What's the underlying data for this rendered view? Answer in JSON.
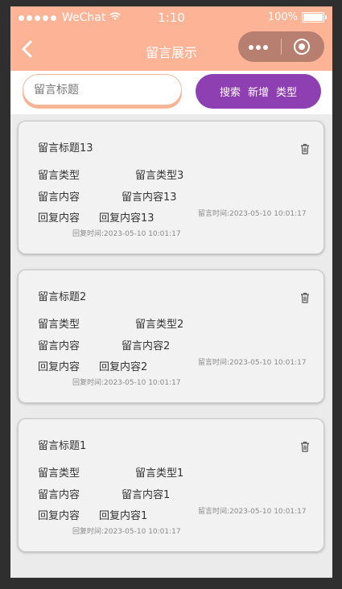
{
  "status_bar": {
    "carrier": "WeChat",
    "time": "1:10",
    "battery": "100%"
  },
  "nav": {
    "title": "留言展示"
  },
  "search": {
    "placeholder": "留言标题",
    "buttons": [
      "搜索",
      "新增",
      "类型"
    ]
  },
  "messages": [
    {
      "title": "留言标题13",
      "type_label": "留言类型",
      "type_value": "留言类型3",
      "content_label": "留言内容",
      "content_value": "留言内容13",
      "reply_label": "回复内容",
      "reply_value": "回复内容13",
      "message_time": "留言时间:2023-05-10 10:01:17",
      "reply_time": "回复时间:2023-05-10 10:01:17"
    },
    {
      "title": "留言标题2",
      "type_label": "留言类型",
      "type_value": "留言类型2",
      "content_label": "留言内容",
      "content_value": "留言内容2",
      "reply_label": "回复内容",
      "reply_value": "回复内容2",
      "message_time": "留言时间:2023-05-10 10:01:17",
      "reply_time": "回复时间:2023-05-10 10:01:17"
    },
    {
      "title": "留言标题1",
      "type_label": "留言类型",
      "type_value": "留言类型1",
      "content_label": "留言内容",
      "content_value": "留言内容1",
      "reply_label": "回复内容",
      "reply_value": "回复内容1",
      "message_time": "留言时间:2023-05-10 10:01:17",
      "reply_time": "回复时间:2023-05-10 10:01:17"
    }
  ]
}
